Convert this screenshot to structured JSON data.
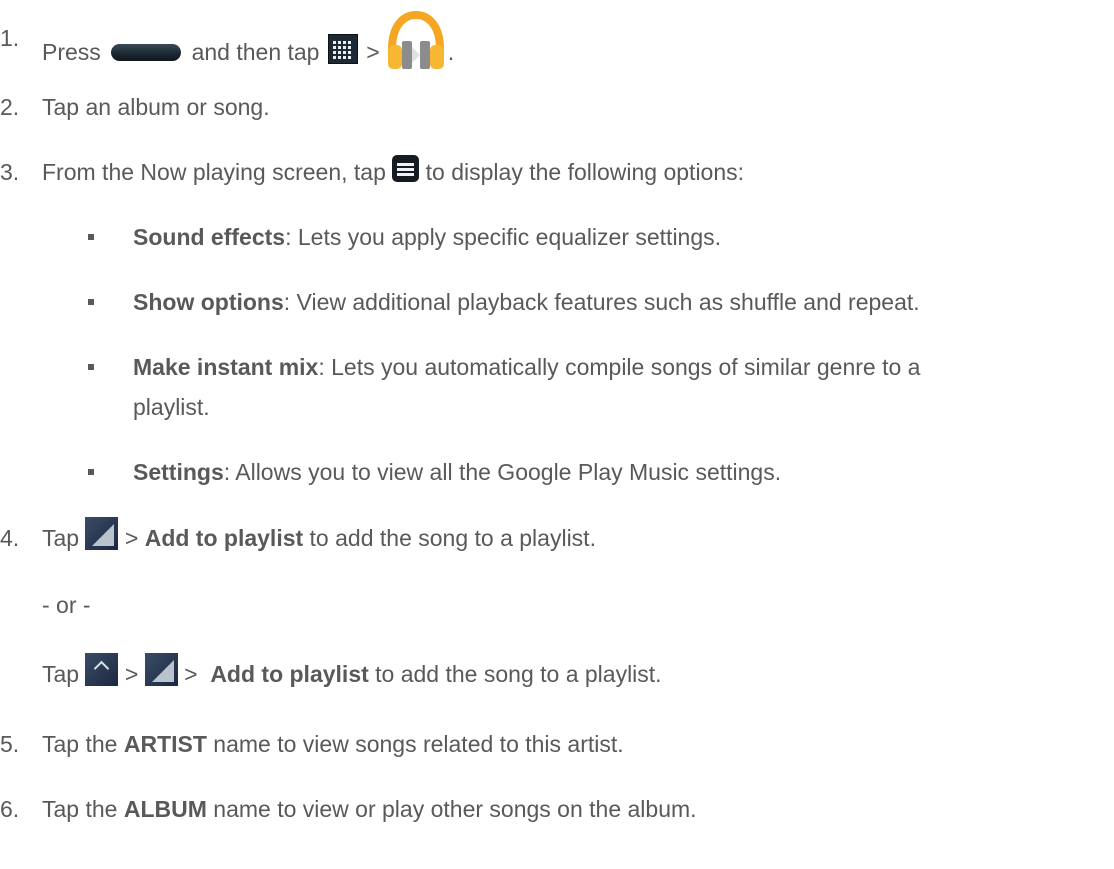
{
  "steps": [
    {
      "num": "1.",
      "a": "Press",
      "b": "and then tap",
      "c": ">",
      "d": "."
    },
    {
      "num": "2.",
      "text": "Tap an album or song."
    },
    {
      "num": "3.",
      "a": "From the Now playing screen, tap",
      "b": "to display the following options:"
    },
    {
      "num": "4.",
      "a": "Tap",
      "b": ">",
      "bold": "Add to playlist",
      "c": "to add the song to a playlist."
    },
    {
      "num": "5.",
      "a": "Tap the",
      "bold": "ARTIST",
      "b": "name to view songs related to this artist."
    },
    {
      "num": "6.",
      "a": "Tap the",
      "bold": "ALBUM",
      "b": "name to view or play other songs on the album."
    }
  ],
  "options": [
    {
      "title": "Sound effects",
      "desc": ": Lets you apply specific equalizer settings."
    },
    {
      "title": "Show options",
      "desc": ": View additional playback features such as shuffle and repeat."
    },
    {
      "title": "Make instant mix",
      "desc": ": Lets you automatically compile songs of similar genre to a",
      "desc2": "playlist."
    },
    {
      "title": "Settings",
      "desc": ": Allows you to view all the Google Play Music settings."
    }
  ],
  "alt": {
    "or": "- or -",
    "a": "Tap",
    "b": ">",
    "c": ">",
    "bold": "Add to playlist",
    "d": "to add the song to a playlist."
  },
  "icons": [
    "home-key-icon",
    "apps-grid-icon",
    "play-music-headphones-icon",
    "menu-key-icon",
    "overflow-corner-icon",
    "expand-caret-icon"
  ]
}
